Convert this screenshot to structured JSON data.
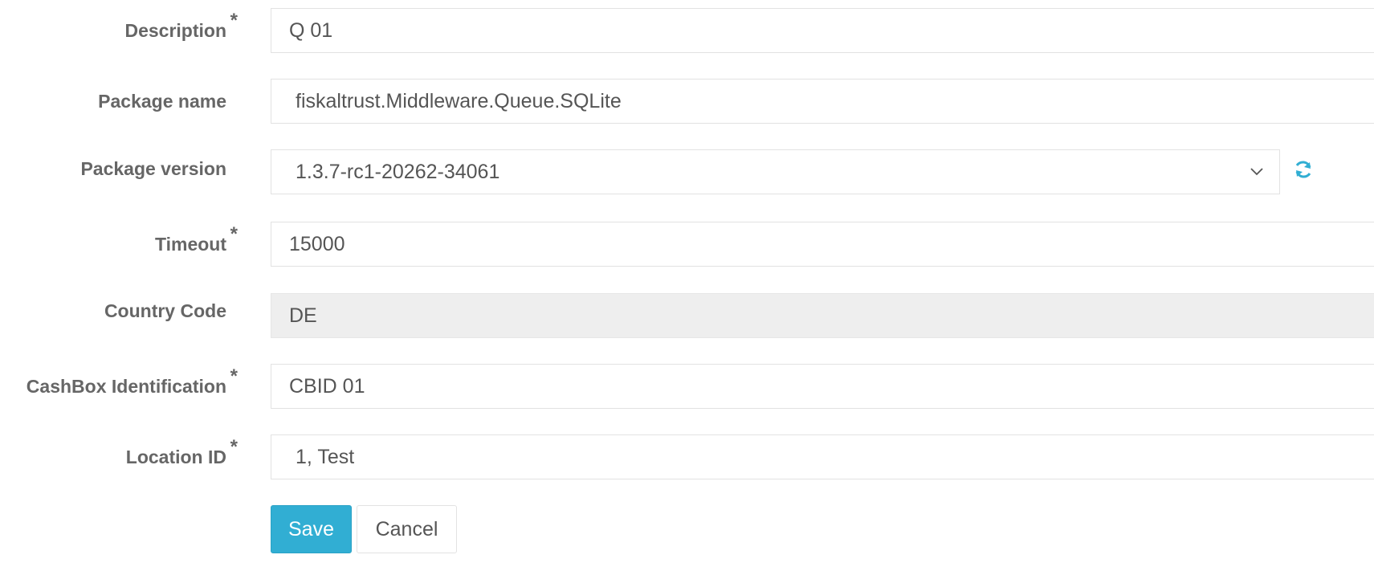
{
  "form": {
    "description": {
      "label": "Description",
      "required_mark": "*",
      "value": "Q 01"
    },
    "package_name": {
      "label": "Package name",
      "value": "fiskaltrust.Middleware.Queue.SQLite"
    },
    "package_version": {
      "label": "Package version",
      "selected": "1.3.7-rc1-20262-34061"
    },
    "timeout": {
      "label": "Timeout",
      "required_mark": "*",
      "value": "15000"
    },
    "country_code": {
      "label": "Country Code",
      "value": "DE"
    },
    "cashbox_identification": {
      "label": "CashBox Identification",
      "required_mark": "*",
      "value": "CBID 01"
    },
    "location_id": {
      "label": "Location ID",
      "required_mark": "*",
      "value": "1, Test"
    }
  },
  "actions": {
    "save_label": "Save",
    "cancel_label": "Cancel"
  },
  "icons": {
    "refresh": "refresh-icon",
    "dropdown": "chevron-down-icon"
  },
  "colors": {
    "accent": "#31aed3",
    "readonly_bg": "#eeeeee",
    "label_text": "#666666"
  }
}
